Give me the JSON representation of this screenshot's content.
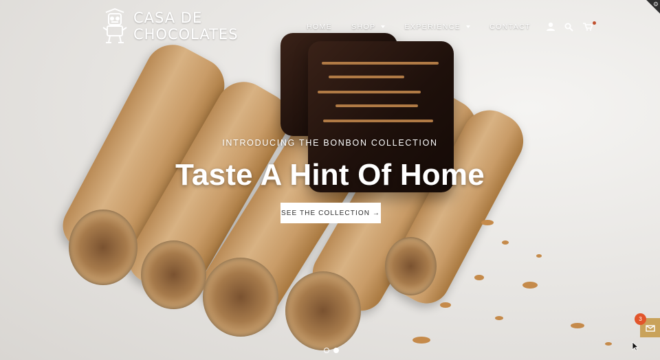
{
  "brand": {
    "line1": "CASA DE",
    "line2": "CHOCOLATES"
  },
  "nav": {
    "items": [
      {
        "label": "HOME",
        "dropdown": false
      },
      {
        "label": "SHOP",
        "dropdown": true
      },
      {
        "label": "EXPERIENCE",
        "dropdown": true
      },
      {
        "label": "CONTACT",
        "dropdown": false
      }
    ],
    "icons": [
      "account-icon",
      "search-icon",
      "cart-icon"
    ]
  },
  "hero": {
    "eyebrow": "INTRODUCING THE BONBON COLLECTION",
    "headline": "Taste A Hint Of Home",
    "cta_label": "SEE THE COLLECTION →"
  },
  "slider": {
    "total": 2,
    "active": 1
  },
  "rewards": {
    "count": "3"
  },
  "colors": {
    "accent_cta": "#ffffff",
    "rewards_bg": "#c9a25a",
    "badge": "#e2552b"
  }
}
